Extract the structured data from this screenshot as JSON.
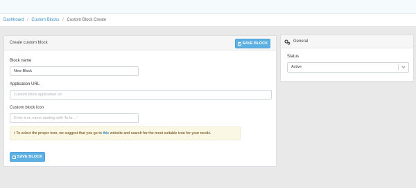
{
  "breadcrumb": {
    "items": [
      "Dashboard",
      "Custom Blocks"
    ],
    "current": "Custom Block Create"
  },
  "main_card": {
    "title": "Create custom block",
    "save_label": "SAVE BLOCK",
    "fields": {
      "block_name": {
        "label": "Block name",
        "value": "New Block"
      },
      "application_url": {
        "label": "Application URL",
        "placeholder": "Custom block application url"
      },
      "block_icon": {
        "label": "Custom block icon",
        "placeholder": "Enter icon name starting with 'fa fa-...'"
      }
    },
    "notice": {
      "info": "i",
      "before": "To select the proper icon, we suggest that you go to ",
      "link": "this",
      "after": " website and search for the most suitable icon for your needs."
    }
  },
  "side_card": {
    "title": "General",
    "status_label": "Status",
    "status_value": "Active"
  },
  "colors": {
    "accent": "#5db0e2",
    "link": "#3a8cc5",
    "notice_bg": "#fbf7e5",
    "notice_text": "#8a6d3b"
  },
  "icons": [
    "gear-icon",
    "save-icon",
    "info-icon",
    "chevron-down-icon"
  ]
}
